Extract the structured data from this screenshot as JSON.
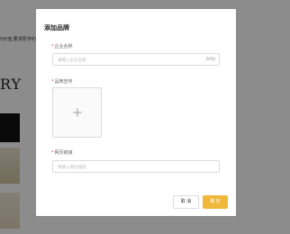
{
  "background": {
    "text_line": "5价值,要求原字约",
    "big_text": "RY"
  },
  "dialog": {
    "title": "添加品牌",
    "fields": {
      "company": {
        "label": "企业名称",
        "placeholder": "请输入企业名称",
        "counter": "0/50",
        "required_mark": "*"
      },
      "brand": {
        "label": "品牌宣传",
        "required_mark": "*"
      },
      "link": {
        "label": "网页链接",
        "placeholder": "请输入网页链接",
        "required_mark": "*"
      }
    },
    "buttons": {
      "cancel": "取 消",
      "ok": "确 定"
    }
  },
  "colors": {
    "accent": "#f0b83a",
    "required": "#e05050",
    "overlay": "rgba(0,0,0,0.45)"
  },
  "icons": {
    "upload": "plus-icon"
  }
}
